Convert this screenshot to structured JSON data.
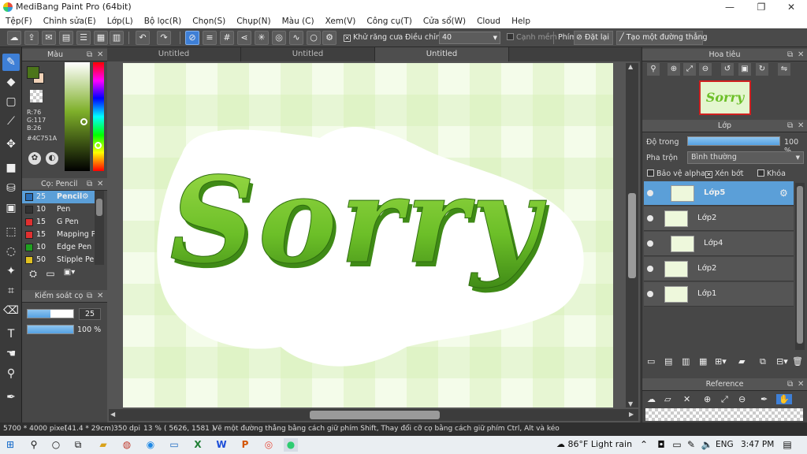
{
  "window": {
    "title": "MediBang Paint Pro (64bit)",
    "minimize": "—",
    "maximize": "❐",
    "close": "✕"
  },
  "menu": [
    "Tệp(F)",
    "Chỉnh sửa(E)",
    "Lớp(L)",
    "Bộ lọc(R)",
    "Chọn(S)",
    "Chụp(N)",
    "Màu (C)",
    "Xem(V)",
    "Công cụ(T)",
    "Cửa sổ(W)",
    "Cloud",
    "Help"
  ],
  "toolbar": {
    "antialias_label": "Khử răng cưa",
    "correction_label": "Điều chỉnh",
    "correction_value": "40",
    "soft_edge_label": "Cạnh mềm",
    "key_label": "Phím",
    "reset_label": "Đặt lại",
    "straight_line_label": "Tạo một đường thẳng"
  },
  "color_panel": {
    "title": "Màu",
    "primary_color": "#4C751A",
    "secondary_color": "#f3d3b8",
    "r": "R:76",
    "g": "G:117",
    "b": "B:26",
    "hex": "#4C751A"
  },
  "brush_panel": {
    "title": "Cọ: Pencil",
    "items": [
      {
        "size": "25",
        "name": "Pencil",
        "color": "#2a6fb8"
      },
      {
        "size": "10",
        "name": "Pen",
        "color": "#333333"
      },
      {
        "size": "15",
        "name": "G Pen",
        "color": "#e03030"
      },
      {
        "size": "15",
        "name": "Mapping P",
        "color": "#e03030"
      },
      {
        "size": "10",
        "name": "Edge Pen",
        "color": "#20a020"
      },
      {
        "size": "50",
        "name": "Stipple Pe",
        "color": "#e0c020"
      }
    ]
  },
  "control_panel": {
    "title": "Kiểm soát cọ",
    "size_value": "25",
    "opacity_value": "100 %",
    "size_level": 0.5,
    "opacity_level": 1.0
  },
  "tabs": [
    "Untitled",
    "Untitled",
    "Untitled"
  ],
  "canvas": {
    "text": "Sorry"
  },
  "navigator": {
    "title": "Hoa tiêu",
    "thumb_text": "Sorry"
  },
  "layers_panel": {
    "title": "Lớp",
    "opacity_label": "Độ trong",
    "opacity_value": "100 %",
    "opacity_level": 1.0,
    "blend_label": "Pha trộn",
    "blend_value": "Bình thường",
    "protect_alpha": "Bảo vệ alpha",
    "clipping": "Xén bớt",
    "lock": "Khóa",
    "layers": [
      {
        "name": "Lớp5",
        "selected": true
      },
      {
        "name": "Lớp2",
        "selected": false
      },
      {
        "name": "Lớp4",
        "selected": false
      },
      {
        "name": "Lớp2",
        "selected": false
      },
      {
        "name": "Lớp1",
        "selected": false
      }
    ]
  },
  "reference_panel": {
    "title": "Reference"
  },
  "status": {
    "size": "5700 * 4000 pixel",
    "cm": "(41.4 * 29cm)",
    "dpi": "350 dpi",
    "zoom": "13 %",
    "coords": "( 5626, 1581 )",
    "hint": "Vẽ một đường thẳng bằng cách giữ phím Shift, Thay đổi cỡ cọ bằng cách giữ phím Ctrl, Alt và kéo"
  },
  "taskbar": {
    "weather": "86°F  Light rain",
    "lang": "ENG",
    "time": "3:47 PM"
  }
}
